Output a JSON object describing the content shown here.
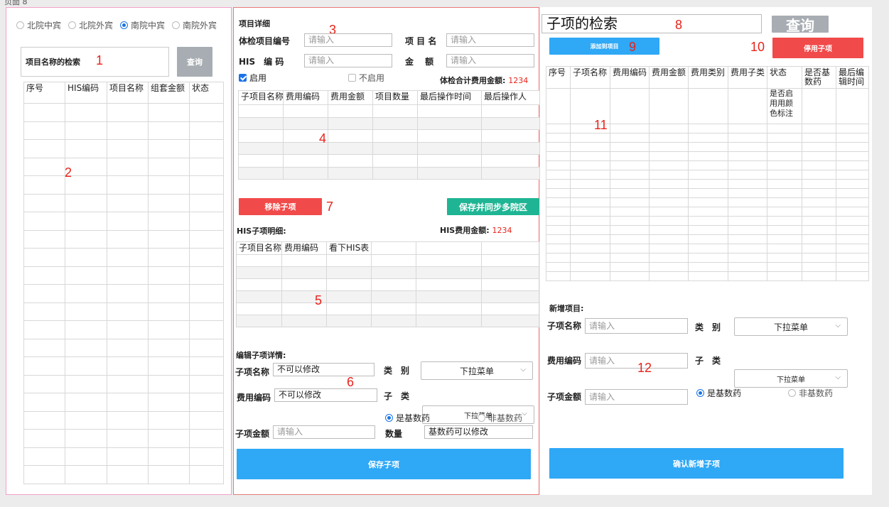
{
  "page": {
    "header": "页面 8"
  },
  "markers": [
    "1",
    "2",
    "3",
    "4",
    "5",
    "6",
    "7",
    "8",
    "9",
    "10",
    "11",
    "12"
  ],
  "left": {
    "radios": [
      {
        "label": "北院中宾",
        "checked": false
      },
      {
        "label": "北院外宾",
        "checked": false
      },
      {
        "label": "南院中宾",
        "checked": true
      },
      {
        "label": "南院外宾",
        "checked": false
      }
    ],
    "search_label": "项目名称的检索",
    "query_btn": "查询",
    "table_headers": [
      "序号",
      "HIS编码",
      "项目名称",
      "组套金额",
      "状态"
    ]
  },
  "mid": {
    "section_title": "项目详细",
    "code_label": "体检项目编号",
    "code_ph": "请输入",
    "name_label": "项 目 名",
    "name_ph": "请输入",
    "his_label": "HIS　编 码",
    "his_ph": "请输入",
    "amount_label": "金　 额",
    "amount_ph": "请输入",
    "enable_label": "启用",
    "disable_label": "不启用",
    "total_label": "体检合计费用金额:",
    "total_value": "1234",
    "sub_headers": [
      "子项目名称",
      "费用编码",
      "费用金额",
      "项目数量",
      "最后操作时间",
      "最后操作人"
    ],
    "remove_btn": "移除子项",
    "save_sync_btn": "保存并同步多院区",
    "his_detail_label": "HIS子项明细:",
    "his_fee_label": "HIS费用金额:",
    "his_fee_value": "1234",
    "his_headers": [
      "子项目名称",
      "费用编码",
      "看下HIS表",
      "",
      "",
      ""
    ],
    "edit_title": "编辑子项详情:",
    "edit_name_label": "子项名称",
    "edit_name_value": "不可以修改",
    "edit_cat_label": "类　别",
    "edit_cat_value": "下拉菜单",
    "edit_fee_label": "费用编码",
    "edit_fee_value": "不可以修改",
    "edit_sub_label": "子　类",
    "edit_sub_value": "下拉菜单",
    "basic_drug": "是基数药",
    "non_basic_drug": "非基数药",
    "edit_amount_label": "子项金额",
    "edit_amount_ph": "请输入",
    "qty_label": "数量",
    "qty_value": "基数药可以修改",
    "save_sub_btn": "保存子项"
  },
  "right": {
    "search_text": "子项的检索",
    "query_btn": "查询",
    "add_btn": "添加到项目",
    "disable_btn": "停用子项",
    "table_headers": [
      "序号",
      "子项名称",
      "费用编码",
      "费用金额",
      "费用类别",
      "费用子类",
      "状态",
      "是否基数药",
      "最后编辑时间"
    ],
    "status_note": "是否启用用颜色标注",
    "new_title": "新增项目:",
    "new_name_label": "子项名称",
    "new_name_ph": "请输入",
    "new_cat_label": "类　别",
    "new_cat_value": "下拉菜单",
    "new_fee_label": "费用编码",
    "new_fee_ph": "请输入",
    "new_sub_label": "子　类",
    "new_sub_value": "下拉菜单",
    "new_amount_label": "子项金额",
    "new_amount_ph": "请输入",
    "basic_drug": "是基数药",
    "non_basic_drug": "非基数药",
    "confirm_btn": "确认新增子项"
  }
}
